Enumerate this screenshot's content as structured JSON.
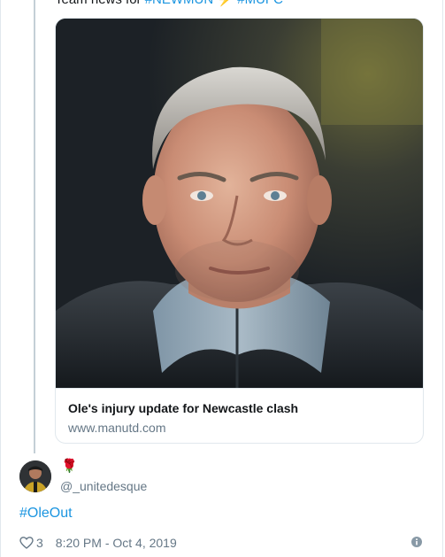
{
  "quoted_tweet": {
    "text_prefix": "Team news for ",
    "hashtag_1": "#NEWMUN",
    "hashtag_2": "#MUFC"
  },
  "link_card": {
    "title": "Ole's injury update for Newcastle clash",
    "domain": "www.manutd.com"
  },
  "tweet": {
    "display_name_emoji": "🌹",
    "handle": "@_unitedesque",
    "text": "#OleOut",
    "like_count": "3",
    "timestamp": "8:20 PM - Oct 4, 2019"
  },
  "icons": {
    "like": "heart-outline-icon",
    "info": "info-icon",
    "bolt": "lightning-bolt-emoji"
  },
  "colors": {
    "link": "#1b95e0",
    "secondary_text": "#657786",
    "border": "#e1e8ed",
    "thread_line": "#c4cfd6"
  }
}
